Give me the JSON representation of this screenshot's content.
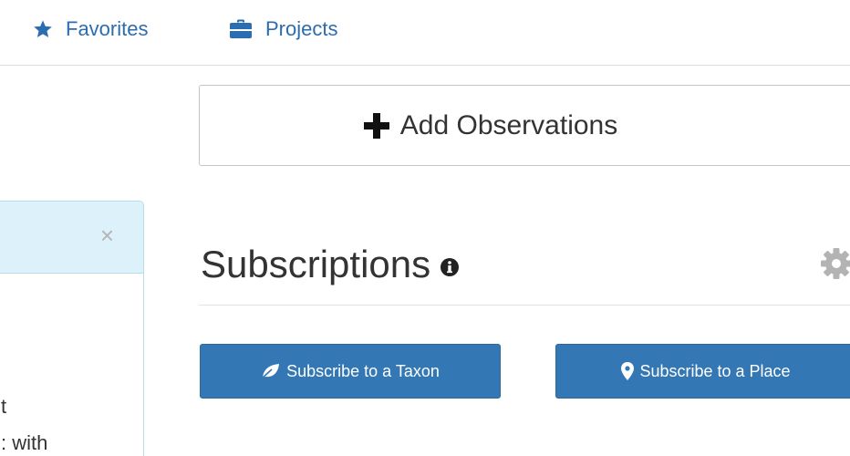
{
  "nav": {
    "favorites_label": "Favorites",
    "projects_label": "Projects"
  },
  "add_observations": {
    "label": "Add Observations"
  },
  "panel": {
    "close_glyph": "×",
    "line_1": "t",
    "line_2": ": with"
  },
  "subscriptions": {
    "title": "Subscriptions",
    "subscribe_taxon_label": "Subscribe to a Taxon",
    "subscribe_place_label": "Subscribe to a Place"
  },
  "icons": {
    "favorites": "star-icon",
    "projects": "briefcase-icon",
    "add": "plus-icon",
    "info": "info-icon",
    "settings": "gear-icon",
    "taxon": "leaf-icon",
    "place": "map-marker-icon",
    "close": "close-icon"
  },
  "colors": {
    "link": "#2a6db0",
    "primary_button": "#3477b5",
    "panel_header": "#dcf1fa",
    "panel_border": "#b6dde8"
  }
}
